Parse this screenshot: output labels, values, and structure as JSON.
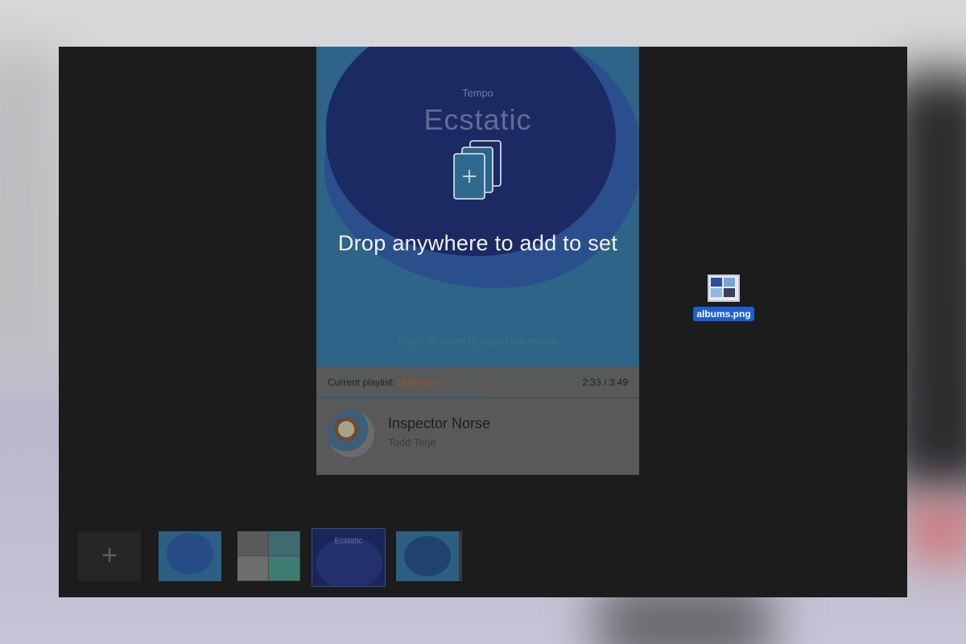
{
  "app": {
    "canvas": {
      "tempo_label": "Tempo",
      "tempo_value": "Ecstatic",
      "pinch_hint": "Pinch or zoom to adjust the tempo"
    },
    "player": {
      "playlist_prefix": "Current playlist: ",
      "playlist_name": "Uptempo",
      "time": "2:33 / 3:49",
      "progress_fraction": 0.53,
      "track_title": "Inspector Norse",
      "track_artist": "Todd Terje"
    },
    "overlay": {
      "message": "Drop anywhere to add to set",
      "icon": "add-to-set-stack-icon"
    },
    "dragged_file": {
      "name": "albums.png"
    },
    "thumbnail_strip": {
      "add_label": "+",
      "active_thumb_title": "Ecstatic"
    }
  },
  "colors": {
    "window_bg": "#1c1c1c",
    "file_selection": "#1c5ed6",
    "playlist_accent": "#a2512a"
  }
}
